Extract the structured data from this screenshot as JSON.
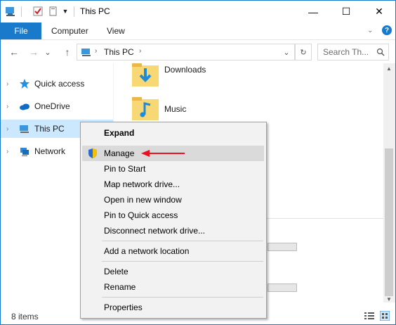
{
  "window": {
    "title": "This PC",
    "minimize_glyph": "—",
    "maximize_glyph": "☐",
    "close_glyph": "✕"
  },
  "ribbon": {
    "file": "File",
    "tabs": [
      "Computer",
      "View"
    ]
  },
  "nav": {
    "back": "←",
    "forward": "→",
    "recent": "⌄",
    "up": "↑",
    "address_location": "This PC",
    "refresh": "↻",
    "search_placeholder": "Search Th..."
  },
  "navpane": [
    {
      "label": "Quick access",
      "icon": "star-icon"
    },
    {
      "label": "OneDrive",
      "icon": "cloud-icon"
    },
    {
      "label": "This PC",
      "icon": "computer-icon"
    },
    {
      "label": "Network",
      "icon": "network-icon"
    }
  ],
  "content": {
    "folders": [
      {
        "label": "Downloads",
        "icon": "downloads-folder-icon"
      },
      {
        "label": "Music",
        "icon": "music-folder-icon"
      }
    ]
  },
  "context_menu": [
    {
      "label": "Expand",
      "bold": true
    },
    {
      "label": "Manage",
      "shield": true,
      "highlighted": true
    },
    {
      "label": "Pin to Start"
    },
    {
      "label": "Map network drive..."
    },
    {
      "label": "Open in new window"
    },
    {
      "label": "Pin to Quick access"
    },
    {
      "label": "Disconnect network drive..."
    },
    {
      "separator": true
    },
    {
      "label": "Add a network location"
    },
    {
      "separator": true
    },
    {
      "label": "Delete"
    },
    {
      "label": "Rename"
    },
    {
      "separator": true
    },
    {
      "label": "Properties"
    }
  ],
  "status": {
    "items_count": "8 items"
  },
  "colors": {
    "accent": "#1979ca",
    "selection": "#cce8ff",
    "arrow": "#e81123"
  }
}
